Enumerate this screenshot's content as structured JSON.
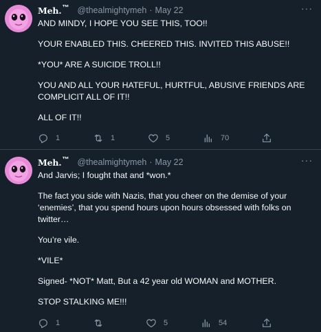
{
  "tweets": [
    {
      "display_name": "Meh.",
      "name_suffix": "™",
      "handle": "@thealmightymeh",
      "separator": "·",
      "date": "May 22",
      "more": "···",
      "paragraphs": [
        "AND MINDY, I HOPE YOU SEE THIS, TOO!!",
        "YOUR ENABLED THIS. CHEERED THIS. INVITED THIS ABUSE!!",
        "*YOU* ARE A SUICIDE TROLL!!",
        "YOU AND ALL YOUR HATEFUL, HURTFUL, ABUSIVE FRIENDS ARE COMPLICIT ALL OF IT!!",
        "ALL OF IT!!"
      ],
      "replies": "1",
      "retweets": "1",
      "likes": "5",
      "views": "70"
    },
    {
      "display_name": "Meh.",
      "name_suffix": "™",
      "handle": "@thealmightymeh",
      "separator": "·",
      "date": "May 22",
      "more": "···",
      "paragraphs": [
        "And Jarvis; I fought that and *won.*",
        "The fact you side with Nazis, that you cheer on the demise of your ‘enemies’, that you spend hours upon hours obsessed with folks on twitter…",
        "You’re vile.",
        "*VILE*",
        "Signed- *NOT* Matt, But a 42 year old WOMAN and MOTHER.",
        "STOP STALKING ME!!!"
      ],
      "replies": "1",
      "retweets": "",
      "likes": "5",
      "views": "54"
    }
  ],
  "colors": {
    "background": "#15202b",
    "text": "#f7f9f9",
    "muted": "#8b98a5",
    "divider": "#38444d",
    "avatar": "#e88fd9"
  },
  "icons": {
    "reply": "reply-icon",
    "retweet": "retweet-icon",
    "like": "heart-icon",
    "views": "views-icon",
    "share": "share-icon",
    "more": "more-icon"
  }
}
